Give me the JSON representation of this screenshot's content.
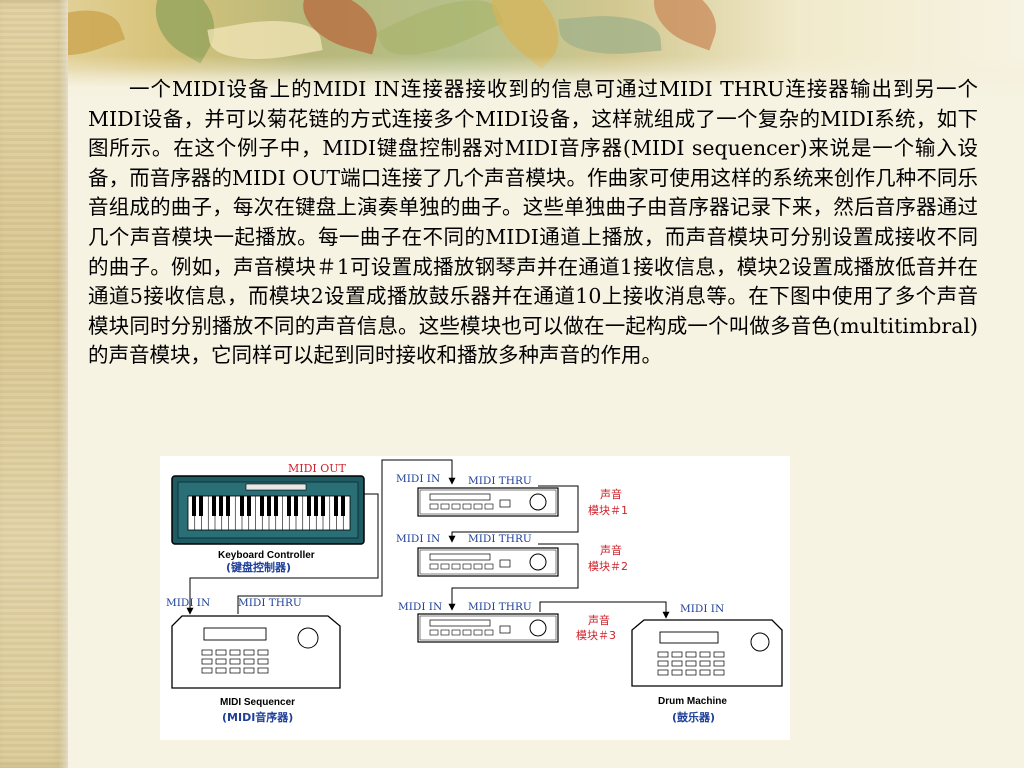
{
  "slide": {
    "paragraph": "一个MIDI设备上的MIDI IN连接器接收到的信息可通过MIDI THRU连接器输出到另一个MIDI设备，并可以菊花链的方式连接多个MIDI设备，这样就组成了一个复杂的MIDI系统，如下图所示。在这个例子中，MIDI键盘控制器对MIDI音序器(MIDI sequencer)来说是一个输入设备，而音序器的MIDI OUT端口连接了几个声音模块。作曲家可使用这样的系统来创作几种不同乐音组成的曲子，每次在键盘上演奏单独的曲子。这些单独曲子由音序器记录下来，然后音序器通过几个声音模块一起播放。每一曲子在不同的MIDI通道上播放，而声音模块可分别设置成接收不同的曲子。例如，声音模块＃1可设置成播放钢琴声并在通道1接收信息，模块2设置成播放低音并在通道5接收信息，而模块2设置成播放鼓乐器并在通道10上接收消息等。在下图中使用了多个声音模块同时分别播放不同的声音信息。这些模块也可以做在一起构成一个叫做多音色(multitimbral)的声音模块，它同样可以起到同时接收和播放多种声音的作用。"
  },
  "diagram": {
    "keyboard": {
      "midi_out_label": "MIDI OUT",
      "name_en": "Keyboard Controller",
      "name_cn": "(键盘控制器)"
    },
    "sequencer": {
      "midi_in_label": "MIDI IN",
      "midi_thru_label": "MIDI THRU",
      "name_en": "MIDI Sequencer",
      "name_cn": "(MIDI音序器)"
    },
    "modules": [
      {
        "midi_in_label": "MIDI IN",
        "midi_thru_label": "MIDI THRU",
        "name_line1": "声音",
        "name_line2": "模块＃1"
      },
      {
        "midi_in_label": "MIDI IN",
        "midi_thru_label": "MIDI THRU",
        "name_line1": "声音",
        "name_line2": "模块＃2"
      },
      {
        "midi_in_label": "MIDI IN",
        "midi_thru_label": "MIDI THRU",
        "name_line1": "声音",
        "name_line2": "模块＃3"
      }
    ],
    "drum": {
      "midi_in_label": "MIDI IN",
      "name_en": "Drum Machine",
      "name_cn": "(鼓乐器)"
    }
  },
  "colors": {
    "label_blue": "#1f3f9a",
    "label_red": "#d0202a",
    "keyboard_panel": "#1e5b63"
  }
}
